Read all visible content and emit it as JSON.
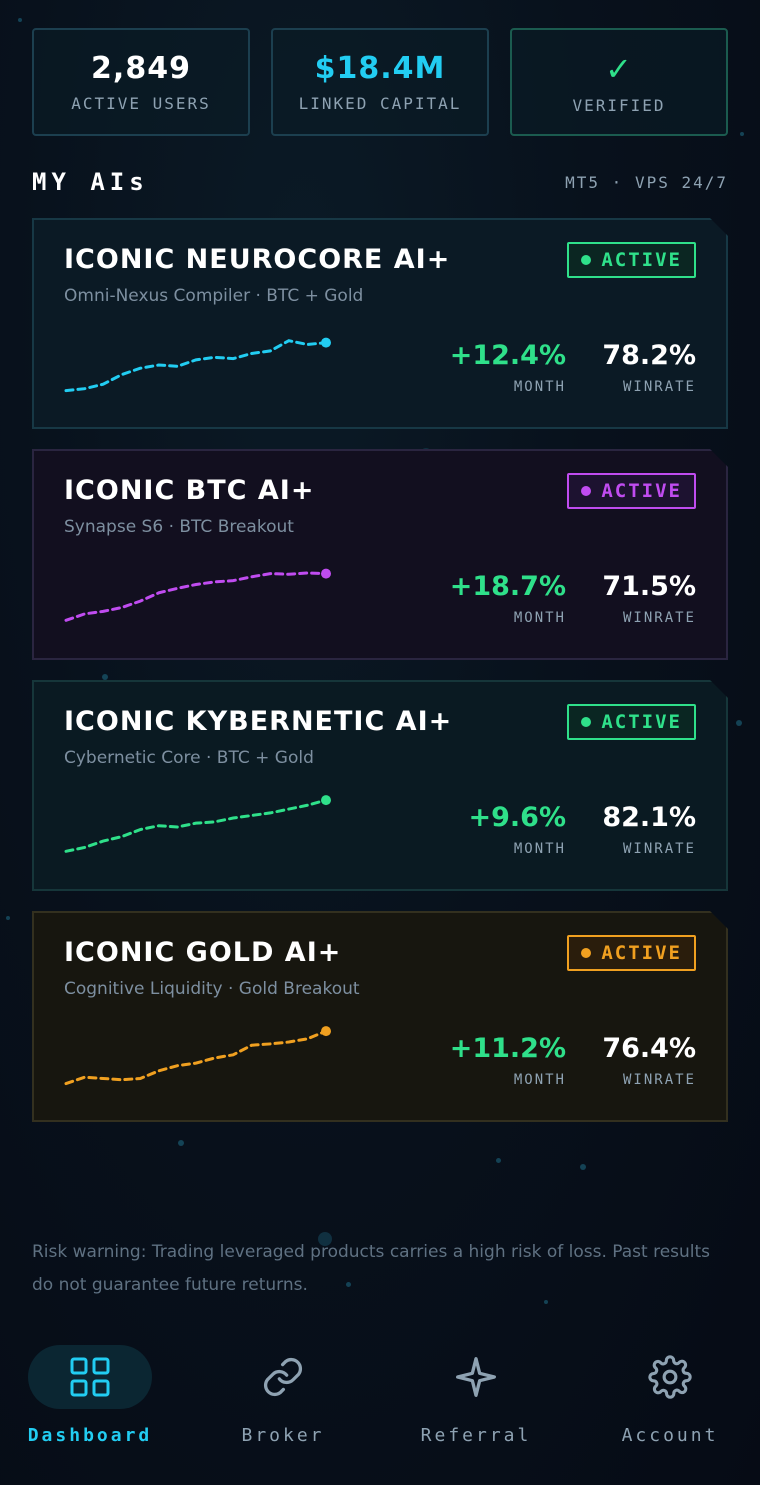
{
  "stats": [
    {
      "value": "2,849",
      "label": "ACTIVE USERS"
    },
    {
      "value": "$18.4M",
      "label": "LINKED CAPITAL"
    },
    {
      "value": "✓",
      "label": "VERIFIED"
    }
  ],
  "section": {
    "title": "MY AIs",
    "meta": "MT5 · VPS 24/7"
  },
  "cards": [
    {
      "title": "ICONIC NEUROCORE AI+",
      "subtitle": "Omni-Nexus Compiler · BTC + Gold",
      "status": "ACTIVE",
      "month_value": "+12.4%",
      "month_label": "MONTH",
      "winrate_value": "78.2%",
      "winrate_label": "WINRATE",
      "accent": "#22cdf2",
      "border": "#173845",
      "bg": "#0b1a25",
      "badge_bg": "#0a2430",
      "status_accent": "#2fe08a",
      "status_bg": "#0b2622",
      "spark": [
        0.1,
        0.13,
        0.2,
        0.35,
        0.45,
        0.5,
        0.48,
        0.58,
        0.62,
        0.6,
        0.68,
        0.72,
        0.88,
        0.82,
        0.85
      ]
    },
    {
      "title": "ICONIC BTC AI+",
      "subtitle": "Synapse S6 · BTC Breakout",
      "status": "ACTIVE",
      "month_value": "+18.7%",
      "month_label": "MONTH",
      "winrate_value": "71.5%",
      "winrate_label": "WINRATE",
      "accent": "#c04cf0",
      "border": "#2a2540",
      "bg": "#120f1f",
      "badge_bg": "#1d1230",
      "status_accent": "#c04cf0",
      "status_bg": "#1d1230",
      "spark": [
        0.12,
        0.22,
        0.26,
        0.32,
        0.42,
        0.55,
        0.62,
        0.68,
        0.72,
        0.74,
        0.8,
        0.85,
        0.84,
        0.86,
        0.85
      ]
    },
    {
      "title": "ICONIC KYBERNETIC AI+",
      "subtitle": "Cybernetic Core · BTC + Gold",
      "status": "ACTIVE",
      "month_value": "+9.6%",
      "month_label": "MONTH",
      "winrate_value": "82.1%",
      "winrate_label": "WINRATE",
      "accent": "#2fe08a",
      "border": "#16363a",
      "bg": "#0a1a22",
      "badge_bg": "#0a2622",
      "status_accent": "#2fe08a",
      "status_bg": "#0a2622",
      "spark": [
        0.12,
        0.18,
        0.28,
        0.35,
        0.46,
        0.52,
        0.5,
        0.56,
        0.58,
        0.64,
        0.68,
        0.72,
        0.78,
        0.84,
        0.92
      ]
    },
    {
      "title": "ICONIC GOLD AI+",
      "subtitle": "Cognitive Liquidity · Gold Breakout",
      "status": "ACTIVE",
      "month_value": "+11.2%",
      "month_label": "MONTH",
      "winrate_value": "76.4%",
      "winrate_label": "WINRATE",
      "accent": "#f0a020",
      "border": "#33301f",
      "bg": "#17160f",
      "badge_bg": "#2a1d0c",
      "status_accent": "#f0a020",
      "status_bg": "#2a1d0c",
      "spark": [
        0.1,
        0.2,
        0.18,
        0.16,
        0.18,
        0.3,
        0.38,
        0.42,
        0.5,
        0.55,
        0.7,
        0.72,
        0.75,
        0.8,
        0.92
      ]
    }
  ],
  "disclaimer": "Risk warning: Trading leveraged products carries a high risk of loss. Past results do not guarantee future returns.",
  "nav": [
    {
      "label": "Dashboard",
      "icon": "grid-icon",
      "active": true
    },
    {
      "label": "Broker",
      "icon": "link-icon",
      "active": false
    },
    {
      "label": "Referral",
      "icon": "sparkle-icon",
      "active": false
    },
    {
      "label": "Account",
      "icon": "gear-icon",
      "active": false
    }
  ]
}
